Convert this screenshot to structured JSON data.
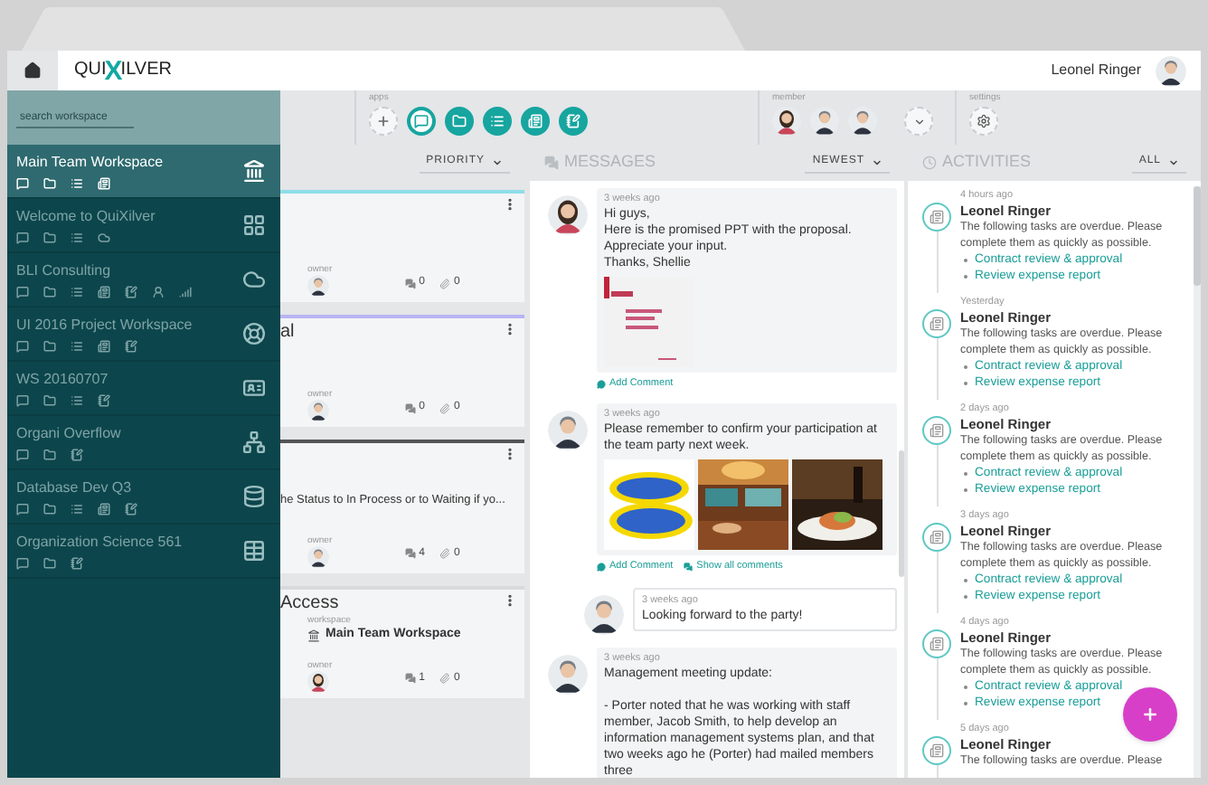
{
  "header": {
    "logo": [
      "QUI",
      "X",
      "ILVER"
    ],
    "user": "Leonel Ringer"
  },
  "toolbar": {
    "search": {
      "placeholder": "search workspace"
    },
    "apps_label": "apps",
    "apps": [
      {
        "kind": "add"
      },
      {
        "kind": "chat",
        "selected": true
      },
      {
        "kind": "folder",
        "selected": false
      },
      {
        "kind": "list",
        "selected": false
      },
      {
        "kind": "board",
        "selected": false
      },
      {
        "kind": "notes",
        "selected": false
      }
    ],
    "member_label": "member",
    "members": [
      {
        "kind": "woman"
      },
      {
        "kind": "man"
      },
      {
        "kind": "man"
      }
    ],
    "settings_label": "settings"
  },
  "sidebar": {
    "workspaces": [
      {
        "name": "Main Team Workspace",
        "selected": true,
        "tools": [
          {
            "kind": "chat"
          },
          {
            "kind": "folder"
          },
          {
            "kind": "list"
          },
          {
            "kind": "board"
          }
        ],
        "kind": "bank"
      },
      {
        "name": "Welcome to QuiXilver",
        "selected": false,
        "tools": [
          {
            "kind": "chat"
          },
          {
            "kind": "folder"
          },
          {
            "kind": "list"
          },
          {
            "kind": "cloud"
          }
        ],
        "kind": "grid"
      },
      {
        "name": "BLI Consulting",
        "selected": false,
        "tools": [
          {
            "kind": "chat"
          },
          {
            "kind": "folder"
          },
          {
            "kind": "list"
          },
          {
            "kind": "board"
          },
          {
            "kind": "notes"
          },
          {
            "kind": "person"
          },
          {
            "kind": "signal"
          }
        ],
        "kind": "cloud"
      },
      {
        "name": "UI 2016 Project Workspace",
        "selected": false,
        "tools": [
          {
            "kind": "chat"
          },
          {
            "kind": "folder"
          },
          {
            "kind": "list"
          },
          {
            "kind": "board"
          },
          {
            "kind": "notes"
          }
        ],
        "kind": "lifebuoy"
      },
      {
        "name": "WS 20160707",
        "selected": false,
        "tools": [
          {
            "kind": "chat"
          },
          {
            "kind": "folder"
          },
          {
            "kind": "list"
          },
          {
            "kind": "notes"
          }
        ],
        "kind": "card"
      },
      {
        "name": "Organi Overflow",
        "selected": false,
        "tools": [
          {
            "kind": "chat"
          },
          {
            "kind": "folder"
          },
          {
            "kind": "notes"
          }
        ],
        "kind": "network"
      },
      {
        "name": "Database Dev Q3",
        "selected": false,
        "tools": [
          {
            "kind": "chat"
          },
          {
            "kind": "folder"
          },
          {
            "kind": "list"
          },
          {
            "kind": "board"
          },
          {
            "kind": "notes"
          }
        ],
        "kind": "database"
      },
      {
        "name": "Organization Science 561",
        "selected": false,
        "tools": [
          {
            "kind": "chat"
          },
          {
            "kind": "folder"
          },
          {
            "kind": "notes"
          }
        ],
        "kind": "table"
      }
    ]
  },
  "tasks": {
    "sort": "PRIORITY",
    "cards": [
      {
        "color": "#8fdde8",
        "owner_label": "owner",
        "owner": {
          "kind": "man"
        },
        "comments": "0",
        "attachments": "0"
      },
      {
        "color": "#b9b4f2",
        "title": "al",
        "owner_label": "owner",
        "owner": {
          "kind": "man"
        },
        "comments": "0",
        "attachments": "0"
      },
      {
        "color": "#555555",
        "description": "he Status to In Process or to Waiting if yo...",
        "owner_label": "owner",
        "owner": {
          "kind": "man"
        },
        "comments": "4",
        "attachments": "0"
      },
      {
        "color": "#d8dadc",
        "title": "Access",
        "workspace_label": "workspace",
        "workspace": "Main Team Workspace",
        "owner_label": "owner",
        "owner": {
          "kind": "woman"
        },
        "comments": "1",
        "attachments": "0"
      }
    ]
  },
  "messages": {
    "title": "MESSAGES",
    "sort": "NEWEST",
    "items": [
      {
        "author": {
          "kind": "woman"
        },
        "reply": false,
        "time": "3 weeks ago",
        "lines": [
          "Hi guys,",
          "Here is the promised PPT with the proposal.",
          "Appreciate your input.",
          "Thanks, Shellie"
        ],
        "attachments": [
          {
            "kind": "slide"
          }
        ],
        "actions": [
          {
            "kind": "comment",
            "label": "Add Comment"
          }
        ]
      },
      {
        "author": {
          "kind": "man"
        },
        "reply": false,
        "time": "3 weeks ago",
        "lines": [
          "Please remember to confirm your participation at the team party next week."
        ],
        "attachments": [
          {
            "kind": "poster"
          },
          {
            "kind": "room"
          },
          {
            "kind": "dinner"
          }
        ],
        "actions": [
          {
            "kind": "comment",
            "label": "Add Comment"
          },
          {
            "kind": "comments",
            "label": "Show all comments"
          }
        ]
      },
      {
        "author": {
          "kind": "man"
        },
        "reply": true,
        "time": "3 weeks ago",
        "lines": [
          "Looking forward to the party!"
        ]
      },
      {
        "author": {
          "kind": "man"
        },
        "reply": false,
        "time": "3 weeks ago",
        "lines": [
          "Management meeting update:",
          "- Porter noted that he was working with staff member, Jacob Smith, to help develop an information management systems plan, and that two weeks ago he (Porter) had mailed members three"
        ]
      }
    ]
  },
  "activities": {
    "title": "ACTIVITIES",
    "filter": "ALL",
    "items": [
      {
        "time": "4 hours ago",
        "name": "Leonel Ringer",
        "text": "The following tasks are overdue. Please complete them as quickly as possible.",
        "links": [
          "Contract review & approval",
          "Review expense report"
        ]
      },
      {
        "time": "Yesterday",
        "name": "Leonel Ringer",
        "text": "The following tasks are overdue. Please complete them as quickly as possible.",
        "links": [
          "Contract review & approval",
          "Review expense report"
        ]
      },
      {
        "time": "2 days ago",
        "name": "Leonel Ringer",
        "text": "The following tasks are overdue. Please complete them as quickly as possible.",
        "links": [
          "Contract review & approval",
          "Review expense report"
        ]
      },
      {
        "time": "3 days ago",
        "name": "Leonel Ringer",
        "text": "The following tasks are overdue. Please complete them as quickly as possible.",
        "links": [
          "Contract review & approval",
          "Review expense report"
        ]
      },
      {
        "time": "4 days ago",
        "name": "Leonel Ringer",
        "text": "The following tasks are overdue. Please complete them as quickly as possible.",
        "links": [
          "Contract review & approval",
          "Review expense report"
        ]
      },
      {
        "time": "5 days ago",
        "name": "Leonel Ringer",
        "text": "The following tasks are overdue. Please"
      }
    ]
  }
}
